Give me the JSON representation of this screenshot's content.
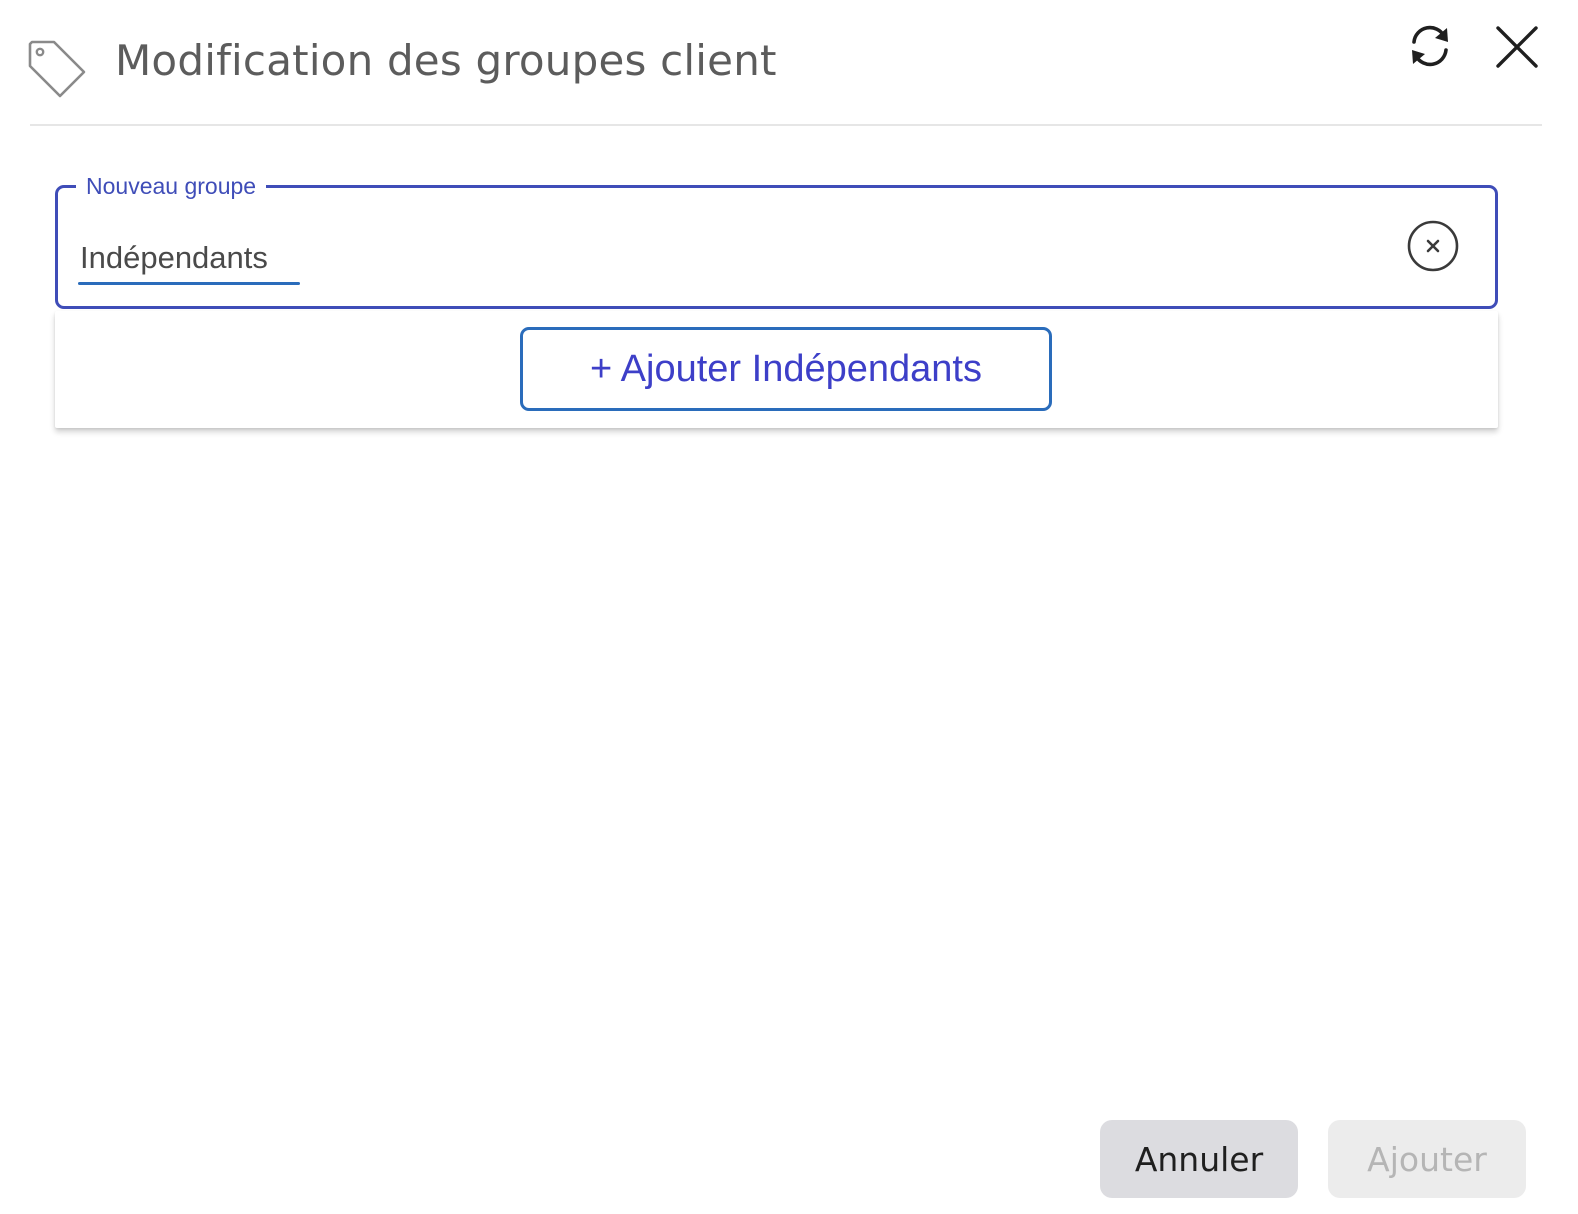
{
  "dialog": {
    "title": "Modification des groupes client",
    "icons": {
      "title_icon": "tag-icon",
      "refresh": "refresh-icon",
      "close": "close-icon"
    }
  },
  "field": {
    "label": "Nouveau groupe",
    "value": "Indépendants",
    "clear_icon": "clear-circle-icon"
  },
  "dropdown": {
    "add_option_label": "+ Ajouter Indépendants"
  },
  "footer": {
    "cancel_label": "Annuler",
    "add_label": "Ajouter",
    "add_disabled": true
  },
  "colors": {
    "accent": "#3f4db8",
    "option_text": "#3d3fc8",
    "option_border": "#2a6cbb",
    "title_text": "#5c5c5c",
    "cancel_bg": "#dcdce0",
    "disabled_bg": "#ececec"
  }
}
